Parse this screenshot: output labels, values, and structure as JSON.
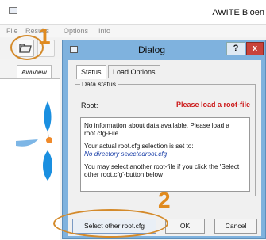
{
  "app": {
    "title": "AWITE Bioen",
    "menu": [
      "File",
      "Results",
      "Options",
      "Info"
    ],
    "side_tab": "AwiView"
  },
  "annotations": {
    "step1": "1",
    "step2": "2"
  },
  "dialog": {
    "title": "Dialog",
    "help": "?",
    "close": "x",
    "tabs": [
      "Status",
      "Load Options"
    ],
    "group_title": "Data status",
    "root_label": "Root:",
    "root_value": "Please load a root-file",
    "info_line1": "No information about data available. Please load a root.cfg-File.",
    "info_line2": "Your actual root.cfg selection is set to:",
    "info_line3": "No directory selectedroot.cfg",
    "info_line4": "You may select another root-file if you click the 'Select other root.cfg'-button below",
    "buttons": {
      "select": "Select other root.cfg",
      "ok": "OK",
      "cancel": "Cancel"
    }
  },
  "colors": {
    "dialog_frame": "#7fb2de",
    "error_text": "#cc1a1a",
    "annotation": "#e08a1e",
    "close_button": "#c9423a"
  }
}
